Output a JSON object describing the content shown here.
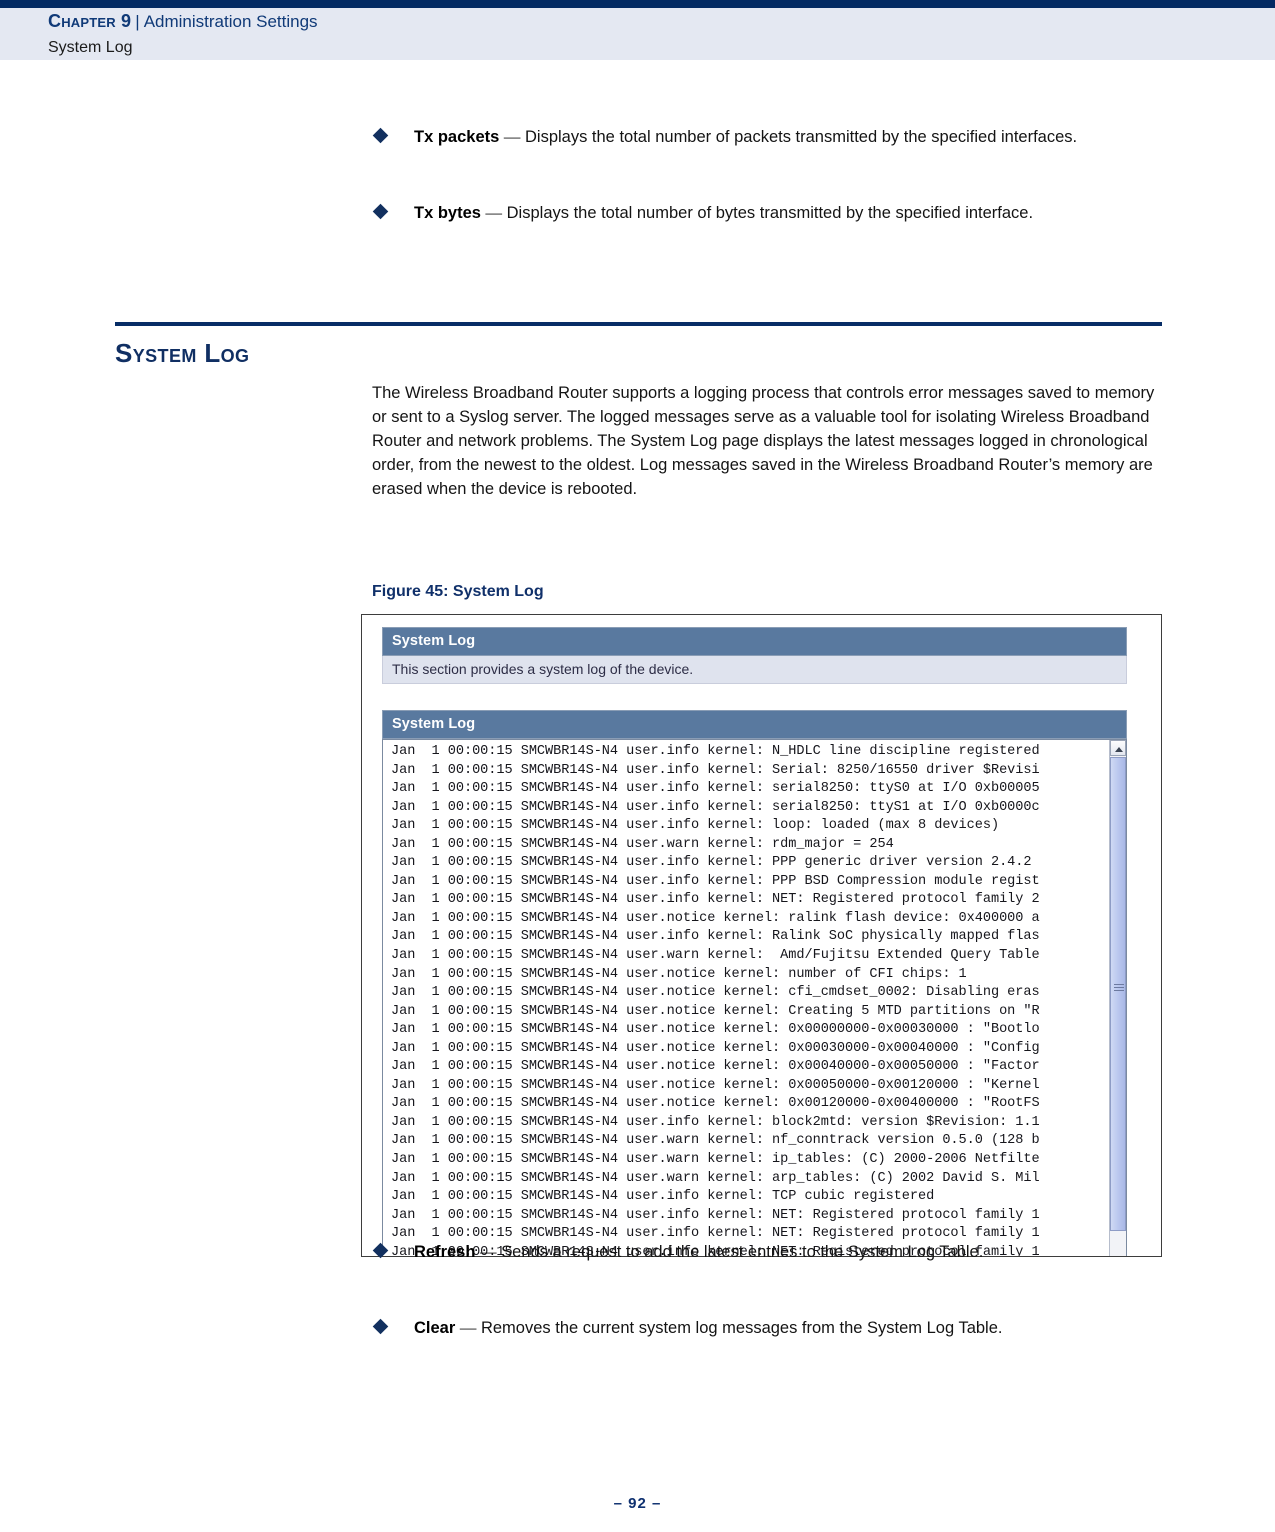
{
  "header": {
    "chapter_label": "Chapter 9",
    "separator": "|",
    "chapter_title": "Administration Settings",
    "running_subtitle": "System Log"
  },
  "top_bullets": [
    {
      "term": "Tx packets",
      "dash": "—",
      "description": "Displays the total number of packets transmitted by the specified interfaces."
    },
    {
      "term": "Tx bytes",
      "dash": "—",
      "description": "Displays the total number of bytes transmitted by the specified interface."
    }
  ],
  "section": {
    "heading": "System Log",
    "paragraph": "The Wireless Broadband Router supports a logging process that controls error messages saved to memory or sent to a Syslog server. The logged messages serve as a valuable tool for isolating Wireless Broadband Router and network problems. The System Log page displays the latest messages logged in chronological order, from the newest to the oldest. Log messages saved in the Wireless Broadband Router’s memory are erased when the device is rebooted."
  },
  "figure": {
    "caption": "Figure 45:  System Log",
    "panel_title": "System Log",
    "panel_description": "This section provides a system log of the device.",
    "log_panel_title": "System Log",
    "scrollbar": {
      "up_arrow_icon": "chevron-up-icon",
      "thumb_position": "top"
    },
    "log_lines": [
      "Jan  1 00:00:15 SMCWBR14S-N4 user.info kernel: N_HDLC line discipline registered",
      "Jan  1 00:00:15 SMCWBR14S-N4 user.info kernel: Serial: 8250/16550 driver $Revisi",
      "Jan  1 00:00:15 SMCWBR14S-N4 user.info kernel: serial8250: ttyS0 at I/O 0xb00005",
      "Jan  1 00:00:15 SMCWBR14S-N4 user.info kernel: serial8250: ttyS1 at I/O 0xb0000c",
      "Jan  1 00:00:15 SMCWBR14S-N4 user.info kernel: loop: loaded (max 8 devices)",
      "Jan  1 00:00:15 SMCWBR14S-N4 user.warn kernel: rdm_major = 254",
      "Jan  1 00:00:15 SMCWBR14S-N4 user.info kernel: PPP generic driver version 2.4.2",
      "Jan  1 00:00:15 SMCWBR14S-N4 user.info kernel: PPP BSD Compression module regist",
      "Jan  1 00:00:15 SMCWBR14S-N4 user.info kernel: NET: Registered protocol family 2",
      "Jan  1 00:00:15 SMCWBR14S-N4 user.notice kernel: ralink flash device: 0x400000 a",
      "Jan  1 00:00:15 SMCWBR14S-N4 user.info kernel: Ralink SoC physically mapped flas",
      "Jan  1 00:00:15 SMCWBR14S-N4 user.warn kernel:  Amd/Fujitsu Extended Query Table",
      "Jan  1 00:00:15 SMCWBR14S-N4 user.notice kernel: number of CFI chips: 1",
      "Jan  1 00:00:15 SMCWBR14S-N4 user.notice kernel: cfi_cmdset_0002: Disabling eras",
      "Jan  1 00:00:15 SMCWBR14S-N4 user.notice kernel: Creating 5 MTD partitions on \"R",
      "Jan  1 00:00:15 SMCWBR14S-N4 user.notice kernel: 0x00000000-0x00030000 : \"Bootlo",
      "Jan  1 00:00:15 SMCWBR14S-N4 user.notice kernel: 0x00030000-0x00040000 : \"Config",
      "Jan  1 00:00:15 SMCWBR14S-N4 user.notice kernel: 0x00040000-0x00050000 : \"Factor",
      "Jan  1 00:00:15 SMCWBR14S-N4 user.notice kernel: 0x00050000-0x00120000 : \"Kernel",
      "Jan  1 00:00:15 SMCWBR14S-N4 user.notice kernel: 0x00120000-0x00400000 : \"RootFS",
      "Jan  1 00:00:15 SMCWBR14S-N4 user.info kernel: block2mtd: version $Revision: 1.1",
      "Jan  1 00:00:15 SMCWBR14S-N4 user.warn kernel: nf_conntrack version 0.5.0 (128 b",
      "Jan  1 00:00:15 SMCWBR14S-N4 user.warn kernel: ip_tables: (C) 2000-2006 Netfilte",
      "Jan  1 00:00:15 SMCWBR14S-N4 user.warn kernel: arp_tables: (C) 2002 David S. Mil",
      "Jan  1 00:00:15 SMCWBR14S-N4 user.info kernel: TCP cubic registered",
      "Jan  1 00:00:15 SMCWBR14S-N4 user.info kernel: NET: Registered protocol family 1",
      "Jan  1 00:00:15 SMCWBR14S-N4 user.info kernel: NET: Registered protocol family 1",
      "Jan  1 00:00:15 SMCWBR14S-N4 user.info kernel: NET: Registered protocol family 1"
    ]
  },
  "bottom_bullets": [
    {
      "term": "Refresh",
      "dash": "—",
      "description": "Sends a request to add the latest entries to the System Log Table."
    },
    {
      "term": "Clear",
      "dash": "—",
      "description": "Removes the current system log messages from the System Log Table."
    }
  ],
  "footer": {
    "page_number": "–  92  –"
  },
  "colors": {
    "navy": "#032a63",
    "header_band": "#e4e8f2",
    "panel_title_bg": "#59799f",
    "panel_desc_bg": "#dfe3ee",
    "scroll_thumb": "#b9c6ee"
  }
}
